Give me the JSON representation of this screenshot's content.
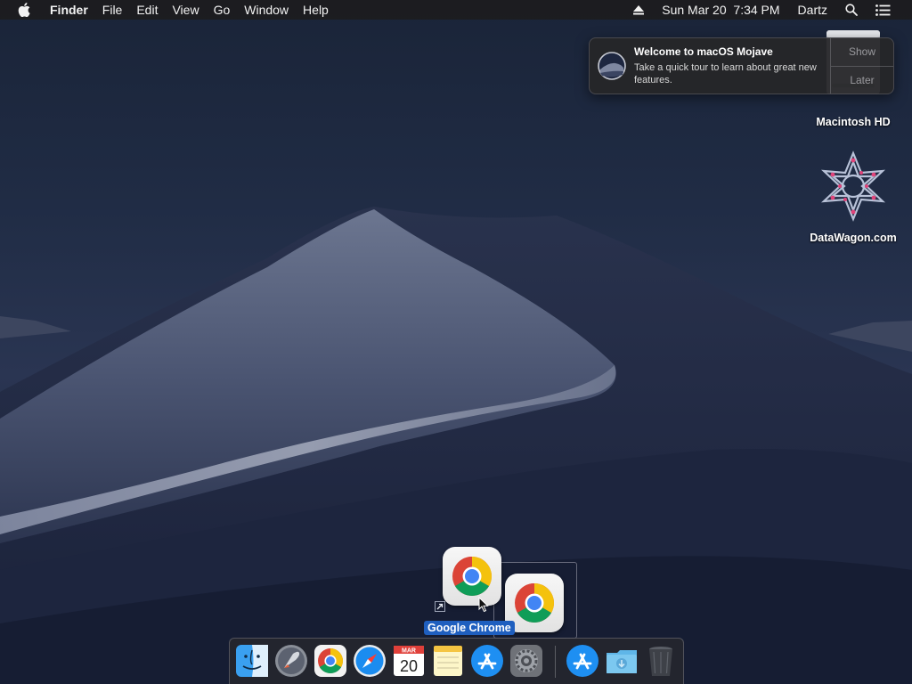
{
  "menubar": {
    "apple_icon": "apple-icon",
    "app_name": "Finder",
    "menus": [
      "File",
      "Edit",
      "View",
      "Go",
      "Window",
      "Help"
    ],
    "status": {
      "eject_icon": "eject-icon",
      "datetime": "Sun Mar 20  7:34 PM",
      "user": "Dartz",
      "search_icon": "spotlight-icon",
      "notification_icon": "notification-center-icon"
    }
  },
  "desktop_icons": [
    {
      "label": "Macintosh HD",
      "icon": "hard-drive-icon"
    },
    {
      "label": "DataWagon.com",
      "icon": "datawagon-icon"
    }
  ],
  "notification": {
    "title": "Welcome to macOS Mojave",
    "body": "Take a quick tour to learn about great new features.",
    "show_label": "Show",
    "later_label": "Later",
    "icon": "mojave-icon"
  },
  "drag": {
    "label": "Google Chrome",
    "icon": "chrome-icon",
    "alias_icon": "alias-arrow-icon"
  },
  "dock": {
    "items": [
      "Finder",
      "Launchpad",
      "Google Chrome",
      "Safari",
      "Calendar",
      "Notes",
      "App Store",
      "System Preferences",
      "Applications",
      "Downloads",
      "Trash"
    ],
    "calendar_month": "MAR",
    "calendar_day": "20"
  },
  "colors": {
    "menubar": "#1c1c1e",
    "drag_label_bg": "#1f5fbf",
    "chrome_red": "#db4437",
    "chrome_yellow": "#f4c20d",
    "chrome_green": "#0f9d58",
    "chrome_blue": "#4285f4"
  }
}
